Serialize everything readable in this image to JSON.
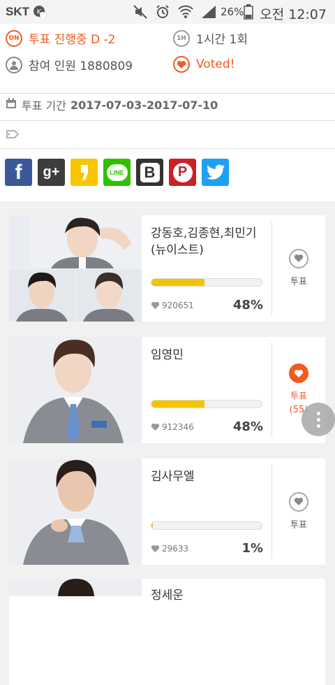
{
  "status_bar": {
    "carrier": "SKT",
    "battery": "26%",
    "time": "오전 12:07"
  },
  "info": {
    "status_badge": "ON",
    "status_text": "투표 진행중 D -2",
    "limit_badge": "1H",
    "limit_text": "1시간 1회",
    "participants": "참여 인원 1880809",
    "voted_text": "Voted!",
    "period_label": "투표 기간",
    "period_value": "2017-07-03-2017-07-10"
  },
  "share": [
    {
      "name": "facebook",
      "glyph": "f",
      "color": "#3b5998"
    },
    {
      "name": "google-plus",
      "glyph": "g+",
      "color": "#3d3d3d"
    },
    {
      "name": "kakaostory",
      "glyph": "",
      "color": "#f9c500"
    },
    {
      "name": "line",
      "glyph": "LINE",
      "color": "#2ec100"
    },
    {
      "name": "band",
      "glyph": "B",
      "color": "#333333"
    },
    {
      "name": "pinterest",
      "glyph": "P",
      "color": "#cb2027"
    },
    {
      "name": "twitter",
      "glyph": "",
      "color": "#1da1f2"
    }
  ],
  "candidates": [
    {
      "name": "강동호,김종현,최민기(뉴이스트)",
      "votes": "920651",
      "percent": "48%",
      "fill": 0.48,
      "vote_label": "투표",
      "vote_count": "",
      "voted": false
    },
    {
      "name": "임영민",
      "votes": "912346",
      "percent": "48%",
      "fill": 0.48,
      "vote_label": "투표",
      "vote_count": "(55)",
      "voted": true
    },
    {
      "name": "김사무엘",
      "votes": "29633",
      "percent": "1%",
      "fill": 0.01,
      "vote_label": "투표",
      "vote_count": "",
      "voted": false
    },
    {
      "name": "정세운",
      "votes": "",
      "percent": "",
      "fill": 0,
      "vote_label": "",
      "vote_count": "",
      "voted": false
    }
  ],
  "colors": {
    "accent": "#f35a1f",
    "progress": "#f5c400"
  }
}
